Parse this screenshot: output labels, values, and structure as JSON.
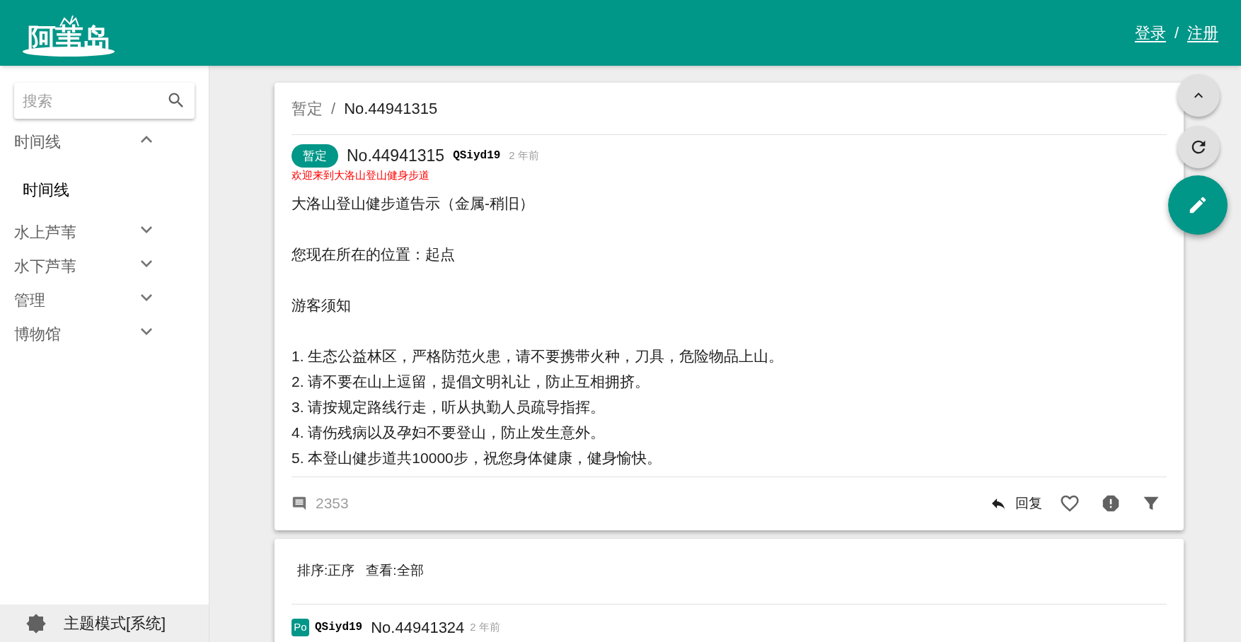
{
  "header": {
    "logo": "阿苇岛",
    "auth": [
      {
        "label": "登录"
      },
      {
        "label": "注册"
      }
    ],
    "separator": "/"
  },
  "sidebar": {
    "search": {
      "placeholder": "搜索"
    },
    "menu": [
      {
        "label": "时间线",
        "expanded": true,
        "children": [
          {
            "label": "时间线",
            "selected": true
          }
        ]
      },
      {
        "label": "水上芦苇",
        "expanded": false
      },
      {
        "label": "水下芦苇",
        "expanded": false
      },
      {
        "label": "管理",
        "expanded": false
      },
      {
        "label": "博物馆",
        "expanded": false
      }
    ],
    "theme": "主题模式[系统]"
  },
  "thread": {
    "breadcrumb": [
      "暂定",
      "No.44941315"
    ],
    "breadcrumb_separator": "/",
    "post": {
      "tag": "暂定",
      "id": "No.44941315",
      "user": "QSiyd19",
      "time": "2 年前",
      "notice": "欢迎来到大洛山登山健身步道",
      "paragraphs": [
        [
          "大洛山登山健步道告示（金属-稍旧）"
        ],
        [
          "您现在所在的位置：起点"
        ],
        [
          "游客须知"
        ],
        [
          "1. 生态公益林区，严格防范火患，请不要携带火种，刀具，危险物品上山。",
          "2. 请不要在山上逗留，提倡文明礼让，防止互相拥挤。",
          "3. 请按规定路线行走，听从执勤人员疏导指挥。",
          "4. 请伤残病以及孕妇不要登山，防止发生意外。",
          "5. 本登山健步道共10000步，祝您身体健康，健身愉快。"
        ]
      ],
      "reply_count": "2353",
      "reply_label": "回复"
    }
  },
  "sort_bar": [
    "排序:正序",
    "查看:全部"
  ],
  "reply": {
    "avatar": "Po",
    "user": "QSiyd19",
    "id": "No.44941324",
    "time": "2 年前"
  }
}
